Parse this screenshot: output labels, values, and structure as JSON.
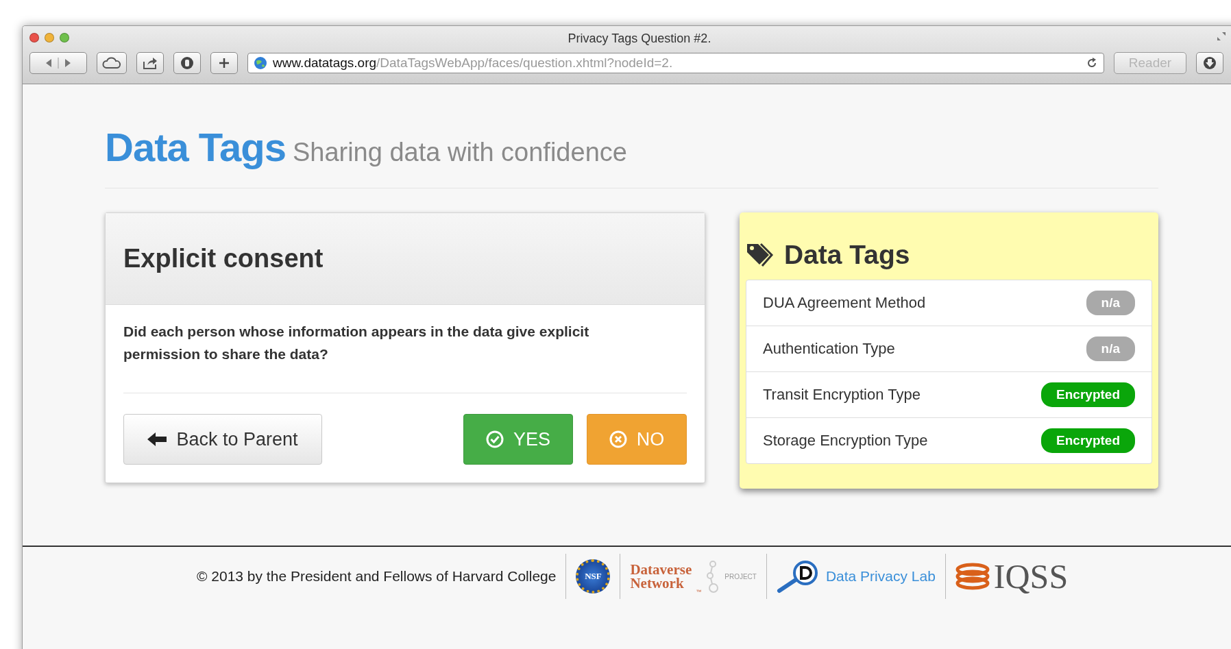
{
  "window": {
    "title": "Privacy Tags Question #2."
  },
  "toolbar": {
    "url_domain": "www.datatags.org",
    "url_path": "/DataTagsWebApp/faces/question.xhtml?nodeId=2.",
    "reader": {
      "label": "Reader",
      "disabled": true
    }
  },
  "header": {
    "title": "Data Tags",
    "subtitle": "Sharing data with confidence"
  },
  "question": {
    "title": "Explicit consent",
    "text": "Did each person whose information appears in the data give explicit permission to share the data?",
    "buttons": [
      {
        "kind": "back",
        "label": "Back to Parent"
      },
      {
        "kind": "yes",
        "label": "YES"
      },
      {
        "kind": "no",
        "label": "NO"
      }
    ]
  },
  "tags": {
    "title": "Data Tags",
    "items": [
      {
        "name": "DUA Agreement Method",
        "value": "n/a",
        "color": "#a9a9a9"
      },
      {
        "name": "Authentication Type",
        "value": "n/a",
        "color": "#a9a9a9"
      },
      {
        "name": "Transit Encryption Type",
        "value": "Encrypted",
        "color": "#0aa60a"
      },
      {
        "name": "Storage Encryption Type",
        "value": "Encrypted",
        "color": "#0aa60a"
      }
    ]
  },
  "footer": {
    "copyright": "© 2013 by the President and Fellows of Harvard College",
    "nsf": "NSF",
    "dataverse": [
      "Dataverse",
      "Network"
    ],
    "dataverse_tm": "™",
    "dataverse_project": "PROJECT",
    "privacy_lab": "Data Privacy Lab",
    "iqss": "IQSS"
  }
}
